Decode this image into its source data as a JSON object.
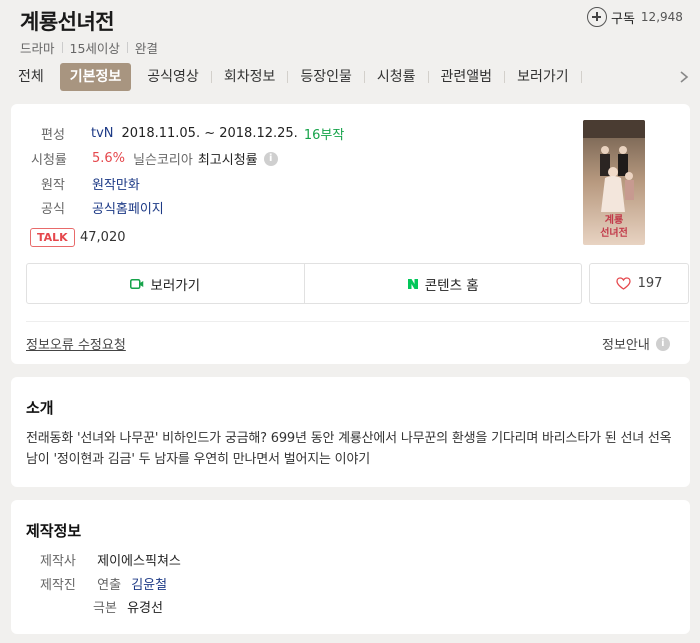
{
  "header": {
    "title": "계룡선녀전",
    "meta": [
      "드라마",
      "15세이상",
      "완결"
    ],
    "subscribe_label": "구독",
    "subscribe_count": "12,948"
  },
  "tabs": [
    "전체",
    "기본정보",
    "공식영상",
    "회차정보",
    "등장인물",
    "시청률",
    "관련앨범",
    "보러가기"
  ],
  "info": {
    "broadcast_label": "편성",
    "channel": "tvN",
    "period": "2018.11.05. ~ 2018.12.25.",
    "episodes": "16부작",
    "rating_label": "시청률",
    "rating": "5.6%",
    "rating_source": "닐슨코리아",
    "rating_type": "최고시청률",
    "origin_label": "원작",
    "origin": "원작만화",
    "official_label": "공식",
    "official": "공식홈페이지",
    "talk_badge": "TALK",
    "talk_count": "47,020",
    "watch_button": "보러가기",
    "contents_button": "콘텐츠 홈",
    "like_count": "197",
    "report_link": "정보오류 수정요청",
    "guide_link": "정보안내"
  },
  "intro": {
    "title": "소개",
    "text": "전래동화 '선녀와 나무꾼' 비하인드가 궁금해? 699년 동안 계룡산에서 나무꾼의 환생을 기다리며 바리스타가 된 선녀 선옥남이 '정이현과 김금' 두 남자를 우연히 만나면서 벌어지는 이야기"
  },
  "production": {
    "title": "제작정보",
    "company_label": "제작사",
    "company": "제이에스픽쳐스",
    "staff_label": "제작진",
    "director_role": "연출",
    "director": "김윤철",
    "writer_role": "극본",
    "writer": "유경선"
  },
  "colors": {
    "active_tab": "#a89580",
    "link": "#1d3a86",
    "green": "#16a34a",
    "red": "#e5484d",
    "naver": "#03c75a"
  }
}
